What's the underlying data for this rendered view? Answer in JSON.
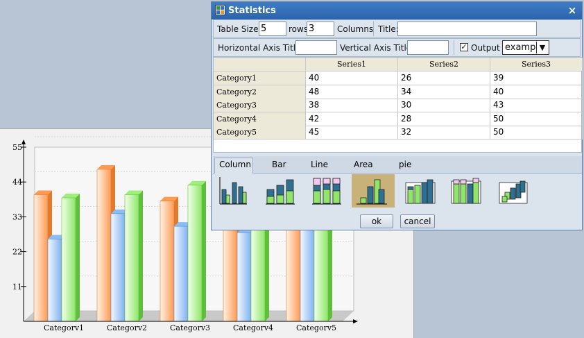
{
  "dialog": {
    "title": "Statistics",
    "close_glyph": "×",
    "table_size_label": "Table Size:",
    "rows_value": "5",
    "rows_label": "rows",
    "columns_value": "3",
    "columns_label": "Columns",
    "title_label": "Title:",
    "title_value": "",
    "h_axis_label": "Horizontal Axis Title:",
    "h_axis_value": "",
    "v_axis_label": "Vertical Axis Title:",
    "v_axis_value": "",
    "output_checked": true,
    "output_label": "Output",
    "output_select_value": "exampl",
    "table": {
      "headers": [
        "",
        "Series1",
        "Series2",
        "Series3"
      ],
      "rows": [
        {
          "label": "Category1",
          "values": [
            "40",
            "26",
            "39"
          ]
        },
        {
          "label": "Category2",
          "values": [
            "48",
            "34",
            "40"
          ]
        },
        {
          "label": "Category3",
          "values": [
            "38",
            "30",
            "43"
          ]
        },
        {
          "label": "Category4",
          "values": [
            "42",
            "28",
            "50"
          ]
        },
        {
          "label": "Category5",
          "values": [
            "45",
            "32",
            "50"
          ]
        }
      ]
    },
    "tabs": [
      "Column",
      "Bar",
      "Line",
      "Area",
      "pie"
    ],
    "active_tab": "Column",
    "thumbnail_icons": [
      "column-clustered-icon",
      "column-stacked-icon",
      "column-percent-stacked-icon",
      "column-3d-clustered-icon",
      "column-3d-stacked-icon",
      "column-3d-percent-stacked-icon",
      "column-3d-icon"
    ],
    "selected_thumbnail": 3,
    "ok_label": "ok",
    "cancel_label": "cancel"
  },
  "colors": {
    "series1": "#ff9a52",
    "series2": "#7fb2f0",
    "series3": "#8fe66a",
    "titlebar": "#3570b8"
  },
  "chart_data": {
    "type": "bar",
    "categories": [
      "Category1",
      "Category2",
      "Category3",
      "Category4",
      "Category5"
    ],
    "series": [
      {
        "values": [
          40,
          48,
          38,
          42,
          45
        ]
      },
      {
        "values": [
          26,
          34,
          30,
          28,
          32
        ]
      },
      {
        "values": [
          39,
          40,
          43,
          50,
          50
        ]
      }
    ],
    "yticks": [
      "11",
      "22",
      "33",
      "44",
      "55"
    ],
    "xtick_labels": [
      "Categorv1",
      "Categorv2",
      "Categorv3",
      "Categorv4",
      "Categorv5"
    ],
    "ylim": [
      0,
      55
    ],
    "grid": true,
    "three_d": true
  }
}
